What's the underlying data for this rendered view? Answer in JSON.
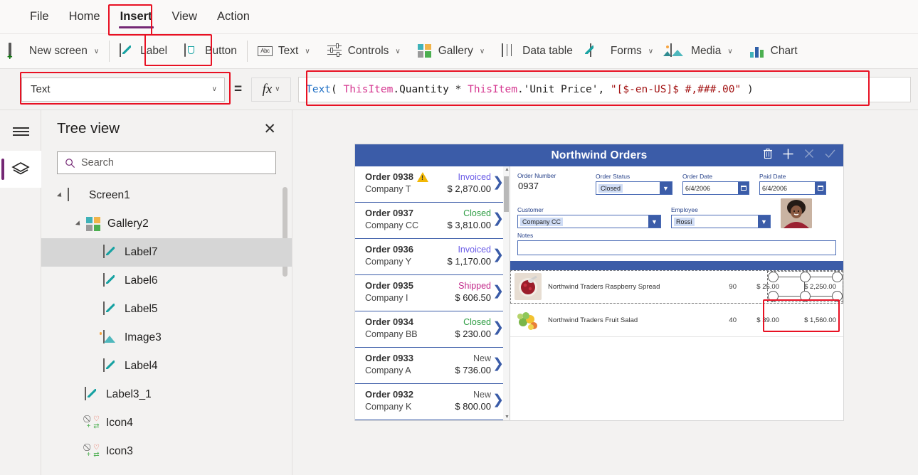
{
  "menu": {
    "items": [
      {
        "label": "File",
        "active": false
      },
      {
        "label": "Home",
        "active": false
      },
      {
        "label": "Insert",
        "active": true
      },
      {
        "label": "View",
        "active": false
      },
      {
        "label": "Action",
        "active": false
      }
    ]
  },
  "ribbon": {
    "items": [
      {
        "label": "New screen",
        "icon": "new-screen-icon",
        "caret": "∨"
      },
      {
        "label": "Label",
        "icon": "label-icon",
        "caret": ""
      },
      {
        "label": "Button",
        "icon": "button-icon",
        "caret": ""
      },
      {
        "label": "Text",
        "icon": "text-abc-icon",
        "caret": "∨"
      },
      {
        "label": "Controls",
        "icon": "controls-sliders-icon",
        "caret": "∨"
      },
      {
        "label": "Gallery",
        "icon": "gallery-grid-icon",
        "caret": "∨"
      },
      {
        "label": "Data table",
        "icon": "data-table-icon",
        "caret": ""
      },
      {
        "label": "Forms",
        "icon": "forms-icon",
        "caret": "∨"
      },
      {
        "label": "Media",
        "icon": "media-image-icon",
        "caret": "∨"
      },
      {
        "label": "Chart",
        "icon": "chart-bar-icon",
        "caret": ""
      }
    ]
  },
  "formula_bar": {
    "property": "Text",
    "property_caret": "∨",
    "equals": "=",
    "fx_label": "fx",
    "fx_caret": "∨",
    "formula_tokens": [
      {
        "t": "Text",
        "c": "fn"
      },
      {
        "t": "( ",
        "c": "pun"
      },
      {
        "t": "ThisItem",
        "c": "obj"
      },
      {
        "t": ".Quantity * ",
        "c": "pun"
      },
      {
        "t": "ThisItem",
        "c": "obj"
      },
      {
        "t": ".'Unit Price', ",
        "c": "pun"
      },
      {
        "t": "\"[$-en-US]$ #,###.00\"",
        "c": "str"
      },
      {
        "t": " )",
        "c": "pun"
      }
    ],
    "formula_plain": "Text( ThisItem.Quantity * ThisItem.'Unit Price', \"[$-en-US]$ #,###.00\" )"
  },
  "rail": {
    "menu_icon": "hamburger-icon",
    "tree_icon": "layers-icon"
  },
  "tree_panel": {
    "title": "Tree view",
    "close_label": "✕",
    "search_placeholder": "Search",
    "search_value": "",
    "nodes": [
      {
        "label": "Screen1",
        "icon": "screen-icon",
        "indent": 0,
        "expander": true,
        "selected": false
      },
      {
        "label": "Gallery2",
        "icon": "gallery-icon",
        "indent": 1,
        "expander": true,
        "selected": false
      },
      {
        "label": "Label7",
        "icon": "label-icon",
        "indent": 2,
        "expander": false,
        "selected": true
      },
      {
        "label": "Label6",
        "icon": "label-icon",
        "indent": 2,
        "expander": false,
        "selected": false
      },
      {
        "label": "Label5",
        "icon": "label-icon",
        "indent": 2,
        "expander": false,
        "selected": false
      },
      {
        "label": "Image3",
        "icon": "image-icon",
        "indent": 2,
        "expander": false,
        "selected": false
      },
      {
        "label": "Label4",
        "icon": "label-icon",
        "indent": 2,
        "expander": false,
        "selected": false
      },
      {
        "label": "Label3_1",
        "icon": "label-icon",
        "indent": 1,
        "expander": false,
        "selected": false
      },
      {
        "label": "Icon4",
        "icon": "icon-set-icon",
        "indent": 1,
        "expander": false,
        "selected": false
      },
      {
        "label": "Icon3",
        "icon": "icon-set-icon",
        "indent": 1,
        "expander": false,
        "selected": false
      }
    ]
  },
  "app": {
    "title": "Northwind Orders",
    "title_actions": [
      {
        "name": "delete-order-icon",
        "glyph": "Ὕ1",
        "dim": false
      },
      {
        "name": "add-order-icon",
        "glyph": "+",
        "dim": false
      },
      {
        "name": "cancel-icon",
        "glyph": "✕",
        "dim": true
      },
      {
        "name": "save-icon",
        "glyph": "✓",
        "dim": true
      }
    ],
    "orders": [
      {
        "order": "Order 0938",
        "company": "Company T",
        "status": "Invoiced",
        "amount": "$ 2,870.00",
        "status_color": "#6b5ce7",
        "warning": true
      },
      {
        "order": "Order 0937",
        "company": "Company CC",
        "status": "Closed",
        "amount": "$ 3,810.00",
        "status_color": "#2f9e44",
        "warning": false
      },
      {
        "order": "Order 0936",
        "company": "Company Y",
        "status": "Invoiced",
        "amount": "$ 1,170.00",
        "status_color": "#6b5ce7",
        "warning": false
      },
      {
        "order": "Order 0935",
        "company": "Company I",
        "status": "Shipped",
        "amount": "$ 606.50",
        "status_color": "#c2298a",
        "warning": false
      },
      {
        "order": "Order 0934",
        "company": "Company BB",
        "status": "Closed",
        "amount": "$ 230.00",
        "status_color": "#2f9e44",
        "warning": false
      },
      {
        "order": "Order 0933",
        "company": "Company A",
        "status": "New",
        "amount": "$ 736.00",
        "status_color": "#555555",
        "warning": false
      },
      {
        "order": "Order 0932",
        "company": "Company K",
        "status": "New",
        "amount": "$ 800.00",
        "status_color": "#555555",
        "warning": false
      }
    ],
    "form": {
      "order_number_label": "Order Number",
      "order_number_value": "0937",
      "order_status_label": "Order Status",
      "order_status_value": "Closed",
      "order_date_label": "Order Date",
      "order_date_value": "6/4/2006",
      "paid_date_label": "Paid Date",
      "paid_date_value": "6/4/2006",
      "customer_label": "Customer",
      "customer_value": "Company CC",
      "employee_label": "Employee",
      "employee_value": "Rossi",
      "notes_label": "Notes",
      "notes_value": ""
    },
    "line_items": [
      {
        "product": "Northwind Traders Raspberry Spread",
        "quantity": "90",
        "unit_price": "$ 25.00",
        "total": "$ 2,250.00",
        "selected": true
      },
      {
        "product": "Northwind Traders Fruit Salad",
        "quantity": "40",
        "unit_price": "$ 39.00",
        "total": "$ 1,560.00",
        "selected": false
      }
    ]
  },
  "colors": {
    "accent_purple": "#742774",
    "annotation_red": "#e81123",
    "app_blue": "#3b5ca8",
    "formula_fn": "#1f6fc4",
    "formula_obj": "#d5358f",
    "formula_str": "#a31515"
  }
}
